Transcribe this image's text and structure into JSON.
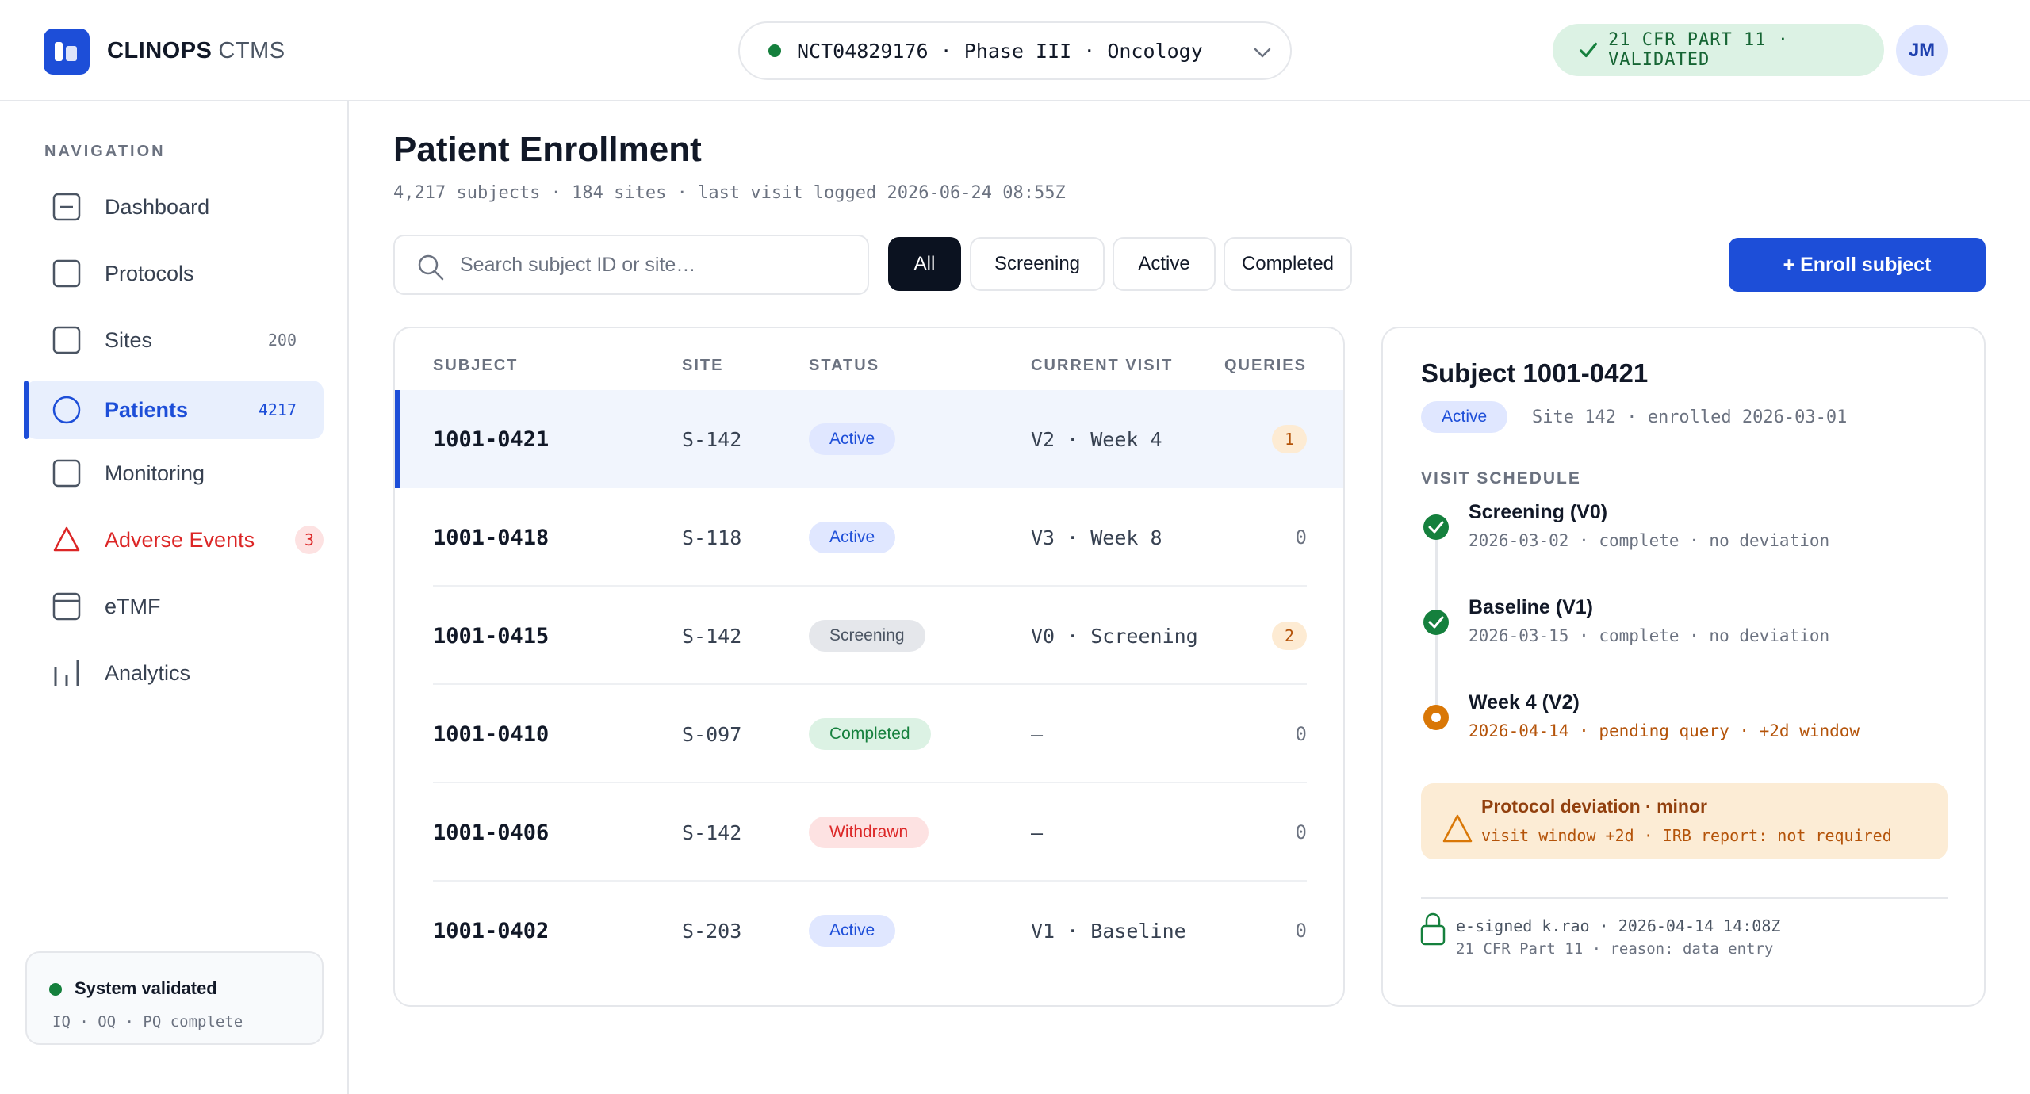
{
  "app": {
    "brand": "CLINOPS",
    "product": "CTMS"
  },
  "header": {
    "study": "NCT04829176 · Phase III · Oncology",
    "compliance": "21 CFR PART 11 · VALIDATED",
    "avatar_initials": "JM",
    "status_color": "#15803d"
  },
  "sidebar": {
    "heading": "NAVIGATION",
    "items": [
      {
        "label": "Dashboard",
        "icon": "dashboard-icon"
      },
      {
        "label": "Protocols",
        "icon": "protocols-icon"
      },
      {
        "label": "Sites",
        "count": "200",
        "icon": "sites-icon"
      },
      {
        "label": "Patients",
        "count": "4217",
        "icon": "patients-icon",
        "active": true
      },
      {
        "label": "Monitoring",
        "icon": "monitoring-icon"
      },
      {
        "label": "Adverse Events",
        "badge": "3",
        "icon": "warning-triangle-icon"
      },
      {
        "label": "eTMF",
        "icon": "etmf-icon"
      },
      {
        "label": "Analytics",
        "icon": "analytics-icon"
      }
    ],
    "system": {
      "title": "System validated",
      "subtitle": "IQ · OQ · PQ complete"
    }
  },
  "main": {
    "title": "Patient Enrollment",
    "subtitle": "4,217 subjects · 184 sites · last visit logged 2026-06-24 08:55Z",
    "search_placeholder": "Search subject ID or site…",
    "filters": [
      "All",
      "Screening",
      "Active",
      "Completed"
    ],
    "active_filter": "All",
    "enroll_label": "+ Enroll subject",
    "accent": "#1d4ed8"
  },
  "table": {
    "columns": [
      "SUBJECT",
      "SITE",
      "STATUS",
      "CURRENT VISIT",
      "QUERIES"
    ],
    "rows": [
      {
        "subject": "1001-0421",
        "site": "S-142",
        "status": "Active",
        "visit": "V2 · Week 4",
        "queries": "1"
      },
      {
        "subject": "1001-0418",
        "site": "S-118",
        "status": "Active",
        "visit": "V3 · Week 8",
        "queries": "0"
      },
      {
        "subject": "1001-0415",
        "site": "S-142",
        "status": "Screening",
        "visit": "V0 · Screening",
        "queries": "2"
      },
      {
        "subject": "1001-0410",
        "site": "S-097",
        "status": "Completed",
        "visit": "—",
        "queries": "0"
      },
      {
        "subject": "1001-0406",
        "site": "S-142",
        "status": "Withdrawn",
        "visit": "—",
        "queries": "0"
      },
      {
        "subject": "1001-0402",
        "site": "S-203",
        "status": "Active",
        "visit": "V1 · Baseline",
        "queries": "0"
      }
    ]
  },
  "detail": {
    "title": "Subject 1001-0421",
    "status": "Active",
    "meta": "Site 142 · enrolled 2026-03-01",
    "schedule_heading": "VISIT SCHEDULE",
    "visits": [
      {
        "title": "Screening (V0)",
        "meta": "2026-03-02 · complete · no deviation",
        "state": "complete"
      },
      {
        "title": "Baseline (V1)",
        "meta": "2026-03-15 · complete · no deviation",
        "state": "complete"
      },
      {
        "title": "Week 4 (V2)",
        "meta": "2026-04-14 · pending query · +2d window",
        "state": "pending"
      }
    ],
    "deviation": {
      "title": "Protocol deviation · minor",
      "subtitle": "visit window +2d · IRB report: not required"
    },
    "signature": {
      "line1": "e-signed k.rao · 2026-04-14 14:08Z",
      "line2": "21 CFR Part 11 · reason: data entry"
    }
  }
}
